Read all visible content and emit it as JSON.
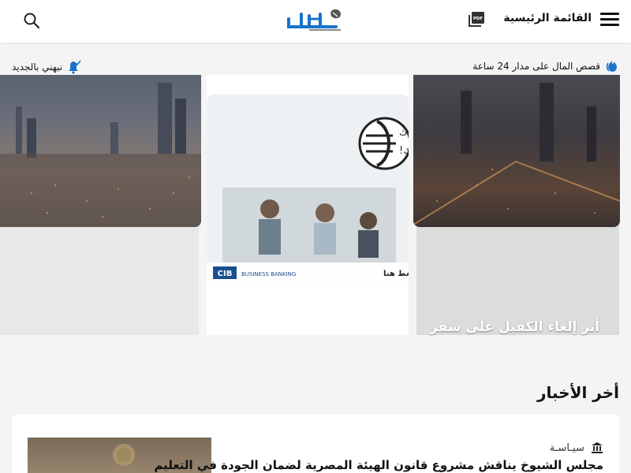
{
  "header": {
    "menu_label": "القائمة الرئيسية"
  },
  "subbar": {
    "ticker_text": "قصص المال على مدار 24 ساعة",
    "notify_text": "نبهني بالجديد"
  },
  "ad": {
    "headline_line1": "برؤيـتك وخبرتنا هنساعدك",
    "headline_line2": "في تنمية حجم استثماراتك!",
    "cta": "اضغط هنا",
    "brand": "CIB",
    "brand_sub": "BUSINESS BANKING"
  },
  "featured": {
    "right_title": "أثر إلغاء الكفيل على سفر"
  },
  "latest": {
    "section_title": "أخر الأخبار",
    "items": [
      {
        "category": "سيـاسـة",
        "title": "مجلس الشيوخ يناقش مشروع قانون الهيئة المصرية لضمان الجودة في التعليم"
      }
    ]
  },
  "colors": {
    "accent_blue": "#1a73c9",
    "header_bg": "#ffffff",
    "page_bg": "#f4f4f4"
  },
  "icons": {
    "menu": "hamburger-icon",
    "pdf": "pdf-icon",
    "search": "search-icon",
    "ticker": "flame-icon",
    "notify": "bell-icon",
    "category": "bank-icon"
  }
}
